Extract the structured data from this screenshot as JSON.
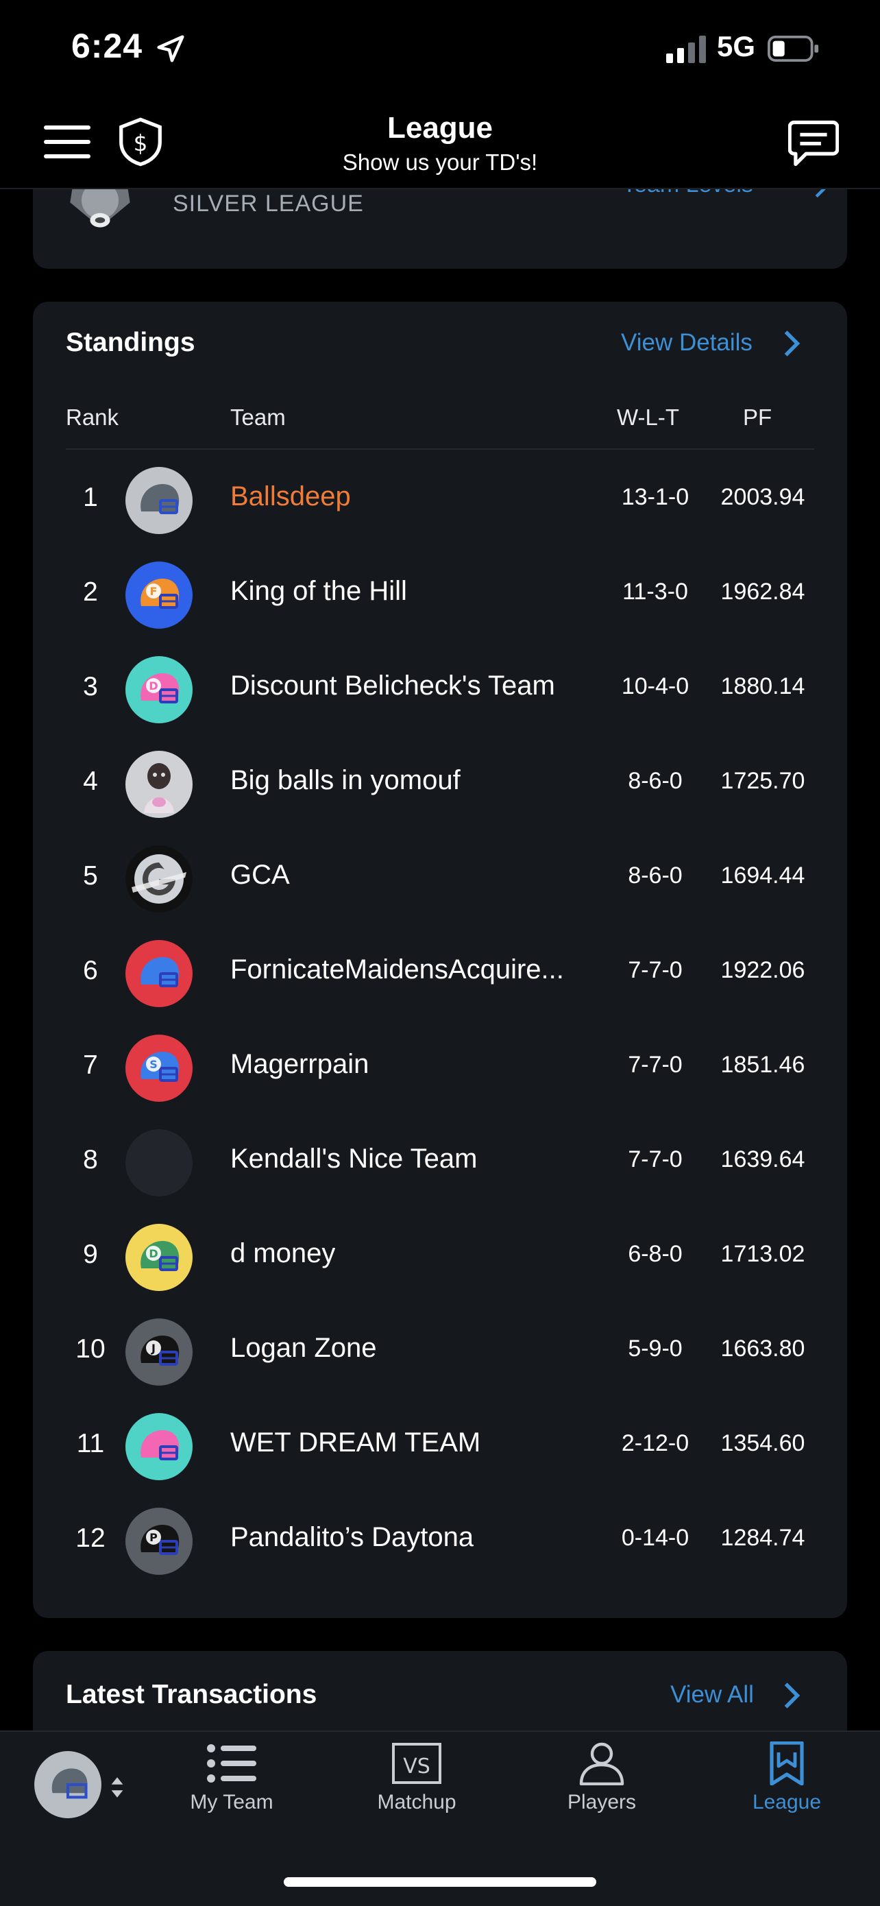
{
  "status_bar": {
    "time": "6:24",
    "network": "5G"
  },
  "header": {
    "title": "League",
    "subtitle": "Show us your TD's!"
  },
  "league_card": {
    "tier_label": "SILVER LEAGUE",
    "team_levels_link": "Team Levels"
  },
  "standings": {
    "title": "Standings",
    "view_details": "View Details",
    "columns": {
      "rank": "Rank",
      "team": "Team",
      "wlt": "W-L-T",
      "pf": "PF"
    },
    "rows": [
      {
        "rank": "1",
        "team": "Ballsdeep",
        "wlt": "13-1-0",
        "pf": "2003.94",
        "avatar": "gray-helmet",
        "letter": ""
      },
      {
        "rank": "2",
        "team": "King of the Hill",
        "wlt": "11-3-0",
        "pf": "1962.84",
        "avatar": "orange-helmet-blue",
        "letter": "F"
      },
      {
        "rank": "3",
        "team": "Discount Belicheck's Team",
        "wlt": "10-4-0",
        "pf": "1880.14",
        "avatar": "pink-helmet-teal",
        "letter": "D"
      },
      {
        "rank": "4",
        "team": "Big balls in yomouf",
        "wlt": "8-6-0",
        "pf": "1725.70",
        "avatar": "photo",
        "letter": ""
      },
      {
        "rank": "5",
        "team": "GCA",
        "wlt": "8-6-0",
        "pf": "1694.44",
        "avatar": "g-logo",
        "letter": ""
      },
      {
        "rank": "6",
        "team": "FornicateMaidensAcquire...",
        "wlt": "7-7-0",
        "pf": "1922.06",
        "avatar": "blue-helmet-red",
        "letter": ""
      },
      {
        "rank": "7",
        "team": "Magerrpain",
        "wlt": "7-7-0",
        "pf": "1851.46",
        "avatar": "blue-helmet-red",
        "letter": "S"
      },
      {
        "rank": "8",
        "team": "Kendall's Nice Team",
        "wlt": "7-7-0",
        "pf": "1639.64",
        "avatar": "empty",
        "letter": ""
      },
      {
        "rank": "9",
        "team": "d money",
        "wlt": "6-8-0",
        "pf": "1713.02",
        "avatar": "green-helmet-yellow",
        "letter": "D"
      },
      {
        "rank": "10",
        "team": "Logan Zone",
        "wlt": "5-9-0",
        "pf": "1663.80",
        "avatar": "black-helmet-gray",
        "letter": "J"
      },
      {
        "rank": "11",
        "team": "WET DREAM TEAM",
        "wlt": "2-12-0",
        "pf": "1354.60",
        "avatar": "pink-helmet-teal",
        "letter": ""
      },
      {
        "rank": "12",
        "team": "Pandalito’s Daytona",
        "wlt": "0-14-0",
        "pf": "1284.74",
        "avatar": "black-helmet-gray",
        "letter": "P"
      }
    ]
  },
  "transactions": {
    "title": "Latest Transactions",
    "view_all": "View All"
  },
  "tabbar": {
    "tabs": [
      {
        "label": "My Team",
        "icon": "list-icon"
      },
      {
        "label": "Matchup",
        "icon": "vs-icon"
      },
      {
        "label": "Players",
        "icon": "person-icon"
      },
      {
        "label": "League",
        "icon": "league-bookmark-icon"
      }
    ],
    "active": "League",
    "colors": {
      "accent": "#3d8fd6",
      "highlight": "#f07c38",
      "card": "#15191e"
    }
  }
}
